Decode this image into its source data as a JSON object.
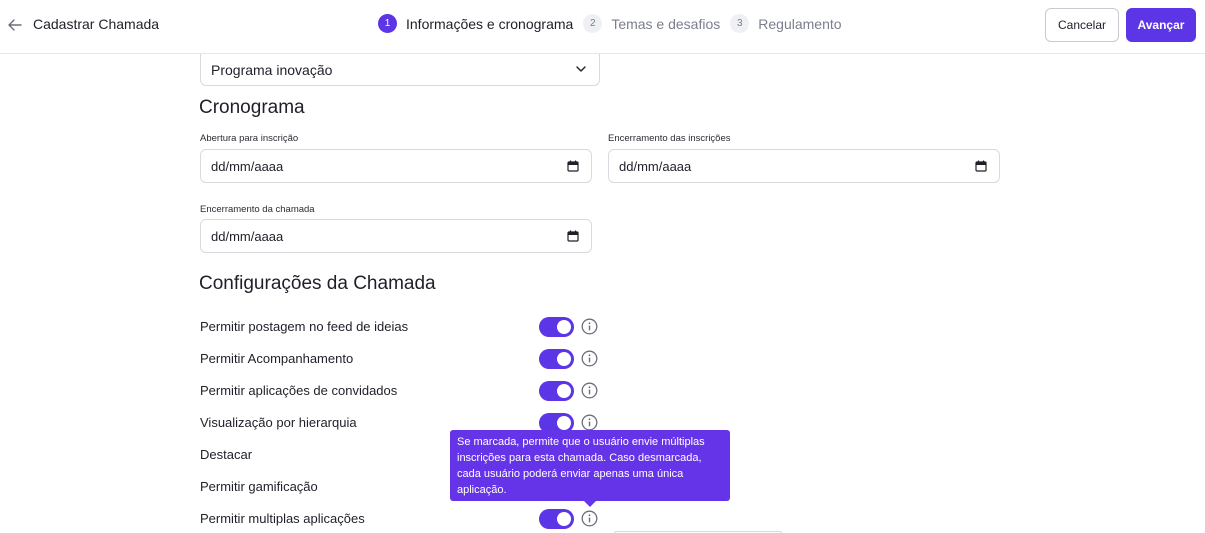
{
  "header": {
    "title": "Cadastrar Chamada",
    "steps": [
      {
        "num": "1",
        "label": "Informações e cronograma"
      },
      {
        "num": "2",
        "label": "Temas e desafios"
      },
      {
        "num": "3",
        "label": "Regulamento"
      }
    ],
    "cancel_label": "Cancelar",
    "next_label": "Avançar"
  },
  "program_select": {
    "value": "Programa inovação"
  },
  "schedule": {
    "heading": "Cronograma",
    "opening_label": "Abertura para inscrição",
    "opening_value": "dd/mm/aaaa",
    "closing_registrations_label": "Encerramento das inscrições",
    "closing_registrations_value": "dd/mm/aaaa",
    "closing_call_label": "Encerramento da chamada",
    "closing_call_value": "dd/mm/aaaa"
  },
  "settings": {
    "heading": "Configurações da Chamada",
    "items": [
      {
        "label": "Permitir postagem no feed de ideias",
        "enabled": true
      },
      {
        "label": "Permitir Acompanhamento",
        "enabled": true
      },
      {
        "label": "Permitir aplicações de convidados",
        "enabled": true
      },
      {
        "label": "Visualização por hierarquia",
        "enabled": true
      },
      {
        "label": "Destacar"
      },
      {
        "label": "Permitir gamificação"
      },
      {
        "label": "Permitir multiplas aplicações",
        "enabled": true
      }
    ],
    "tooltip": "Se marcada, permite que o usuário envie múltiplas inscrições para esta chamada. Caso desmarcada, cada usuário poderá enviar apenas uma única aplicação."
  },
  "colors": {
    "accent": "#5b35e6",
    "tooltip": "#6534e8"
  }
}
